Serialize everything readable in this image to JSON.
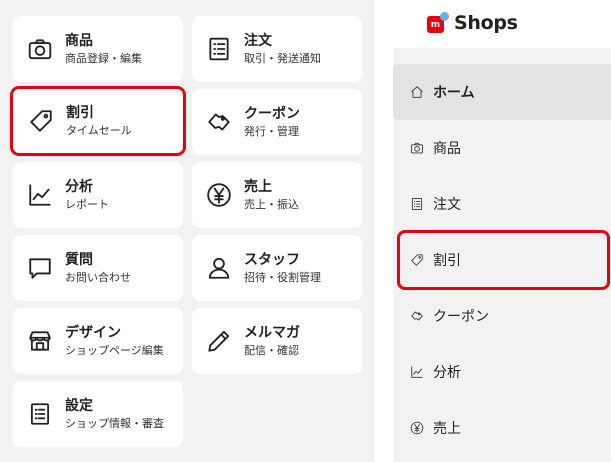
{
  "grid": {
    "items": [
      {
        "title": "商品",
        "sub": "商品登録・編集",
        "icon": "camera-icon"
      },
      {
        "title": "注文",
        "sub": "取引・発送通知",
        "icon": "order-list-icon"
      },
      {
        "title": "割引",
        "sub": "タイムセール",
        "icon": "tag-icon"
      },
      {
        "title": "クーポン",
        "sub": "発行・管理",
        "icon": "coupon-icon"
      },
      {
        "title": "分析",
        "sub": "レポート",
        "icon": "chart-icon"
      },
      {
        "title": "売上",
        "sub": "売上・振込",
        "icon": "yen-icon"
      },
      {
        "title": "質問",
        "sub": "お問い合わせ",
        "icon": "chat-icon"
      },
      {
        "title": "スタッフ",
        "sub": "招待・役割管理",
        "icon": "person-icon"
      },
      {
        "title": "デザイン",
        "sub": "ショップページ編集",
        "icon": "storefront-icon"
      },
      {
        "title": "メルマガ",
        "sub": "配信・確認",
        "icon": "pen-icon"
      },
      {
        "title": "設定",
        "sub": "ショップ情報・審査",
        "icon": "settings-list-icon"
      }
    ]
  },
  "sidebar": {
    "logo_text": "Shops",
    "logo_mark": "m",
    "items": [
      {
        "label": "ホーム",
        "icon": "home-icon"
      },
      {
        "label": "商品",
        "icon": "camera-icon"
      },
      {
        "label": "注文",
        "icon": "order-list-icon"
      },
      {
        "label": "割引",
        "icon": "tag-icon"
      },
      {
        "label": "クーポン",
        "icon": "coupon-icon"
      },
      {
        "label": "分析",
        "icon": "chart-icon"
      },
      {
        "label": "売上",
        "icon": "yen-icon"
      }
    ]
  },
  "colors": {
    "highlight": "#e60012",
    "brand_red": "#e60012",
    "brand_blue": "#5bb7e6",
    "panel_bg": "#f2f2f2"
  }
}
